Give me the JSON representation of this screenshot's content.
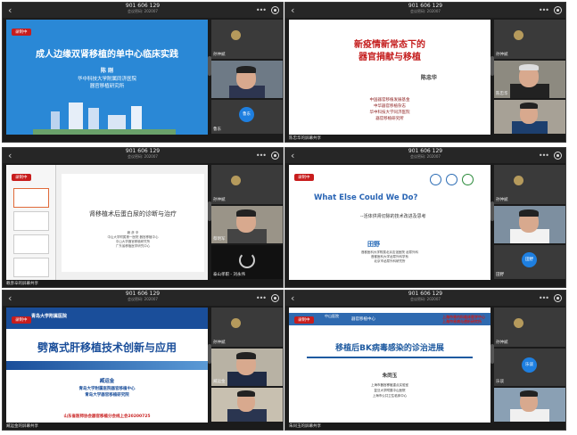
{
  "meeting": {
    "id": "901 606 129",
    "subtitle": "会议密码: 202007"
  },
  "recording_label": "录制中",
  "tiles": [
    {
      "slide": {
        "title": "成人边缘双肾移植的单中心临床实践",
        "presenter": "陈 刚",
        "org": [
          "华中科技大学附属同济医院",
          "器官移植研究所"
        ]
      },
      "participants": [
        {
          "name": "孙仲斌"
        },
        {
          "name": ""
        },
        {
          "name": "鲁东",
          "avatar": "鲁东"
        }
      ],
      "bottom": ""
    },
    {
      "slide": {
        "title": [
          "新疫情新常态下的",
          "器官捐献与移植"
        ],
        "presenter": "陈忠华",
        "org": [
          "中国器官移植发展基金",
          "中华器官移植杂志",
          "华中科技大学同济医院",
          "器官移植研究所"
        ]
      },
      "participants": [
        {
          "name": "孙仲斌"
        },
        {
          "name": "陈忠华"
        },
        {
          "name": ""
        }
      ],
      "bottom": "陈忠华的屏幕共享"
    },
    {
      "slide": {
        "title": "肾移植术后蛋白尿的诊断与治疗",
        "presenter": "赖 彦 辛",
        "org": [
          "中山大学附属第一医院 器官移植中心",
          "中山大学器官移植研究所",
          "广东省移植医学研究中心"
        ]
      },
      "participants": [
        {
          "name": "孙仲斌"
        },
        {
          "name": "蔡明军"
        },
        {
          "name": "泰山孝职 - 刘永伟"
        }
      ],
      "bottom": "赖彦辛的屏幕共享"
    },
    {
      "slide": {
        "title": "What Else Could We Do?",
        "subtitle": "--活体供肾切除的技术改进及思考",
        "presenter": "田野",
        "org": [
          "首都医科大学附属北京友谊医院 泌尿外科",
          "首都医科大学泌尿外科学系",
          "北京市泌尿外科研究所"
        ]
      },
      "participants": [
        {
          "name": "孙仲斌"
        },
        {
          "name": ""
        },
        {
          "name": "田野",
          "avatar": "田野"
        }
      ],
      "bottom": ""
    },
    {
      "slide": {
        "header": "青岛大学附属医院",
        "title": "劈离式肝移植技术创新与应用",
        "presenter": "臧运金",
        "org": [
          "青岛大学附属医院器官移植中心",
          "青岛大学器官移植研究院"
        ],
        "conference": "山东省医师协会器官移植分会线上会20200725"
      },
      "participants": [
        {
          "name": "孙仲斌"
        },
        {
          "name": "臧运金"
        },
        {
          "name": ""
        }
      ],
      "bottom": "臧运金的屏幕共享"
    },
    {
      "slide": {
        "header": "器官移植中心",
        "logo_left": "中山医院",
        "logo_right": [
          "上海市肾内科临床医学中心",
          "上海市肾病与透析研究所"
        ],
        "title": "移植后BK病毒感染的诊治进展",
        "presenter": "朱同玉",
        "org": [
          "上海市器官移植重点实验室",
          "复旦大学附属中山医院",
          "上海市公共卫生临床中心"
        ]
      },
      "participants": [
        {
          "name": "孙仲斌"
        },
        {
          "name": "乐谈"
        },
        {
          "name": ""
        }
      ],
      "bottom": "朱同玉的屏幕共享"
    }
  ]
}
